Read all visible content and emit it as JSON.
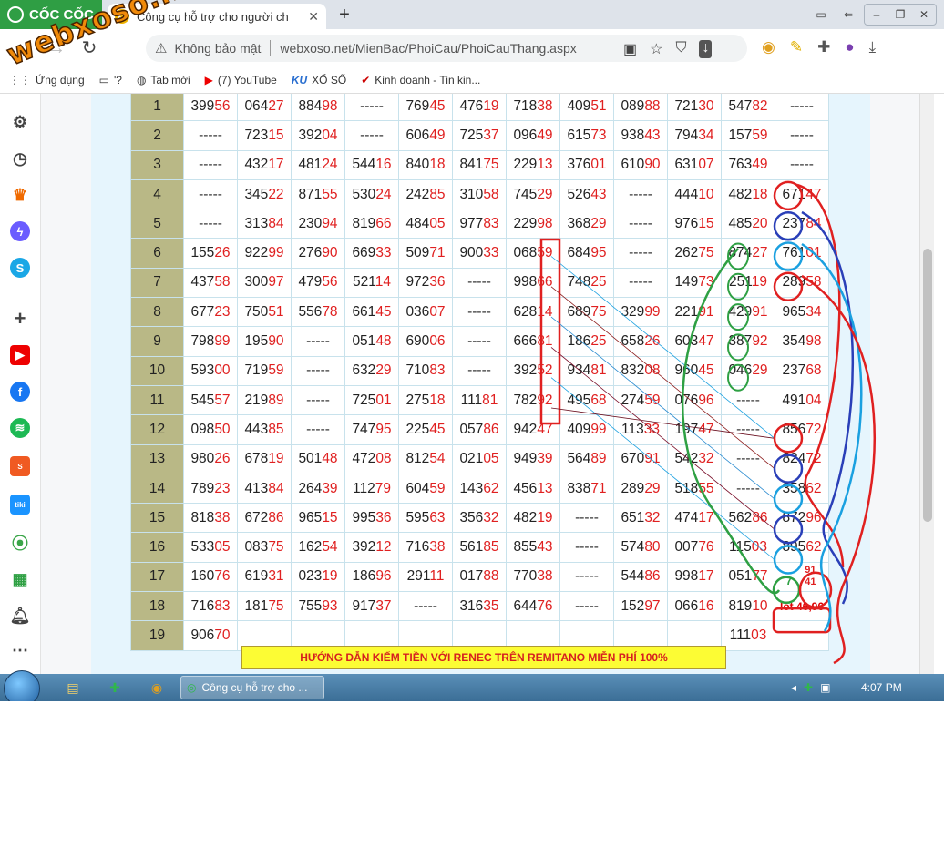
{
  "brand": {
    "name": "CỐC CỐC"
  },
  "tab": {
    "title": "Công cụ hỗ trợ cho người ch",
    "favicon": "XS"
  },
  "address": {
    "security": "Không bảo mật",
    "url": "webxoso.net/MienBac/PhoiCau/PhoiCauThang.aspx"
  },
  "bookmarks": [
    {
      "label": "Ứng dụng",
      "icon": "apps-icon"
    },
    {
      "label": "'?",
      "icon": "folder-icon"
    },
    {
      "label": "Tab mới",
      "icon": "globe-icon"
    },
    {
      "label": "(7) YouTube",
      "icon": "youtube-icon"
    },
    {
      "label": "XỔ SỐ",
      "icon": "ku-icon"
    },
    {
      "label": "Kinh doanh - Tin kin...",
      "icon": "check-icon"
    }
  ],
  "watermark": "webxoso.net",
  "table": {
    "rows": [
      {
        "n": "1",
        "cells": [
          "39956",
          "06427",
          "88498",
          "-----",
          "76945",
          "47619",
          "71838",
          "40951",
          "08988",
          "72130",
          "54782",
          "-----"
        ]
      },
      {
        "n": "2",
        "cells": [
          "-----",
          "72315",
          "39204",
          "-----",
          "60649",
          "72537",
          "09649",
          "61573",
          "93843",
          "79434",
          "15759",
          "-----"
        ]
      },
      {
        "n": "3",
        "cells": [
          "-----",
          "43217",
          "48124",
          "54416",
          "84018",
          "84175",
          "22913",
          "37601",
          "61090",
          "63107",
          "76349",
          "-----"
        ]
      },
      {
        "n": "4",
        "cells": [
          "-----",
          "34522",
          "87155",
          "53024",
          "24285",
          "31058",
          "74529",
          "52643",
          "-----",
          "44410",
          "48218",
          "67147"
        ]
      },
      {
        "n": "5",
        "cells": [
          "-----",
          "31384",
          "23094",
          "81966",
          "48405",
          "97783",
          "22998",
          "36829",
          "-----",
          "97615",
          "48520",
          "23784"
        ]
      },
      {
        "n": "6",
        "cells": [
          "15526",
          "92299",
          "27690",
          "66933",
          "50971",
          "90033",
          "06859",
          "68495",
          "-----",
          "26275",
          "87427",
          "76101"
        ]
      },
      {
        "n": "7",
        "cells": [
          "43758",
          "30097",
          "47956",
          "52114",
          "97236",
          "-----",
          "99866",
          "74825",
          "-----",
          "14973",
          "25119",
          "28958"
        ]
      },
      {
        "n": "8",
        "cells": [
          "67723",
          "75051",
          "55678",
          "66145",
          "03607",
          "-----",
          "62814",
          "68975",
          "32999",
          "22191",
          "42991",
          "96534"
        ]
      },
      {
        "n": "9",
        "cells": [
          "79899",
          "19590",
          "-----",
          "05148",
          "69006",
          "-----",
          "66681",
          "18625",
          "65826",
          "60347",
          "38792",
          "35498"
        ]
      },
      {
        "n": "10",
        "cells": [
          "59300",
          "71959",
          "-----",
          "63229",
          "71083",
          "-----",
          "39252",
          "93481",
          "83208",
          "96045",
          "04629",
          "23768"
        ]
      },
      {
        "n": "11",
        "cells": [
          "54557",
          "21989",
          "-----",
          "72501",
          "27518",
          "11181",
          "78292",
          "49568",
          "27459",
          "07696",
          "-----",
          "49104"
        ]
      },
      {
        "n": "12",
        "cells": [
          "09850",
          "44385",
          "-----",
          "74795",
          "22545",
          "05786",
          "94247",
          "40999",
          "11333",
          "19747",
          "-----",
          "85672"
        ]
      },
      {
        "n": "13",
        "cells": [
          "98026",
          "67819",
          "50148",
          "47208",
          "81254",
          "02105",
          "94939",
          "56489",
          "67091",
          "54232",
          "-----",
          "82472"
        ]
      },
      {
        "n": "14",
        "cells": [
          "78923",
          "41384",
          "26439",
          "11279",
          "60459",
          "14362",
          "45613",
          "83871",
          "28929",
          "51855",
          "-----",
          "35862"
        ]
      },
      {
        "n": "15",
        "cells": [
          "81838",
          "67286",
          "96515",
          "99536",
          "59563",
          "35632",
          "48219",
          "-----",
          "65132",
          "47417",
          "56286",
          "87296"
        ]
      },
      {
        "n": "16",
        "cells": [
          "53305",
          "08375",
          "16254",
          "39212",
          "71638",
          "56185",
          "85543",
          "-----",
          "57480",
          "00776",
          "11503",
          "89562"
        ]
      },
      {
        "n": "17",
        "cells": [
          "16076",
          "61931",
          "02319",
          "18696",
          "29111",
          "01788",
          "77038",
          "-----",
          "54486",
          "99817",
          "05177",
          "7|91 41"
        ]
      },
      {
        "n": "18",
        "cells": [
          "71683",
          "18175",
          "75593",
          "91737",
          "-----",
          "31635",
          "64476",
          "-----",
          "15297",
          "06616",
          "81910",
          "lot 46,96"
        ]
      },
      {
        "n": "19",
        "cells": [
          "90670",
          "",
          "",
          "",
          "",
          "",
          "",
          "",
          "",
          "",
          "11103",
          ""
        ]
      }
    ]
  },
  "annotations": {
    "row17_green": "7",
    "row17_red": "91\n41",
    "lot": "lot 46,96"
  },
  "banner": "HƯỚNG DẪN KIẾM TIỀN VỚI RENEC TRÊN REMITANO MIỄN PHÍ 100%",
  "taskbar": {
    "window_title": "Công cụ hỗ trợ cho ...",
    "time": "4:07 PM"
  },
  "colors": {
    "red": "#e02020",
    "green": "#2ea043",
    "blue": "#2a3fb8",
    "cyan": "#1aa0e0",
    "row_header": "#b9b886"
  }
}
